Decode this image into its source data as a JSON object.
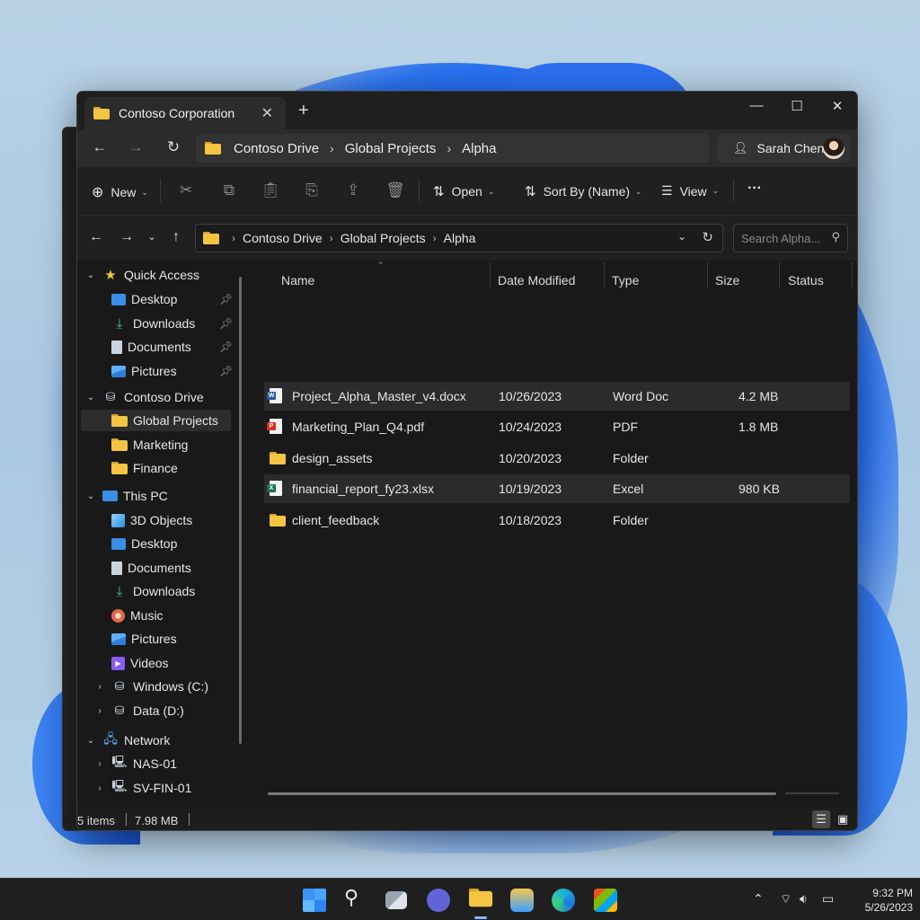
{
  "window": {
    "tab_title": "Contoso Corporation",
    "new_tab": "+",
    "close_tab": "✕",
    "minimize": "—",
    "maximize": "☐",
    "close": "✕"
  },
  "nav": {
    "breadcrumb": [
      "Contoso Drive",
      "Global Projects",
      "Alpha"
    ],
    "account_name": "Sarah Chen"
  },
  "toolbar": {
    "new_label": "New",
    "open_label": "Open",
    "sort_label": "Sort By (Name)",
    "view_label": "View",
    "more_label": "···"
  },
  "address": {
    "breadcrumb": [
      "Contoso Drive",
      "Global Projects",
      "Alpha"
    ],
    "search_placeholder": "Search Alpha..."
  },
  "sidebar": {
    "quick_access": {
      "label": "Quick Access",
      "items": [
        {
          "label": "Desktop",
          "icon": "desktop-icon",
          "pinned": true
        },
        {
          "label": "Downloads",
          "icon": "download-icon",
          "pinned": true
        },
        {
          "label": "Documents",
          "icon": "documents-icon",
          "pinned": true
        },
        {
          "label": "Pictures",
          "icon": "pictures-icon",
          "pinned": true
        }
      ]
    },
    "contoso_drive": {
      "label": "Contoso Drive",
      "items": [
        {
          "label": "Global Projects",
          "icon": "folder-icon",
          "selected": true
        },
        {
          "label": "Marketing",
          "icon": "folder-icon"
        },
        {
          "label": "Finance",
          "icon": "folder-icon"
        }
      ]
    },
    "this_pc": {
      "label": "This PC",
      "items": [
        {
          "label": "3D Objects",
          "icon": "3d-objects-icon"
        },
        {
          "label": "Desktop",
          "icon": "desktop-icon"
        },
        {
          "label": "Documents",
          "icon": "documents-icon"
        },
        {
          "label": "Downloads",
          "icon": "download-icon"
        },
        {
          "label": "Music",
          "icon": "music-icon"
        },
        {
          "label": "Pictures",
          "icon": "pictures-icon"
        },
        {
          "label": "Videos",
          "icon": "videos-icon"
        },
        {
          "label": "Windows (C:)",
          "icon": "drive-icon"
        },
        {
          "label": "Data (D:)",
          "icon": "drive-icon"
        }
      ]
    },
    "network": {
      "label": "Network",
      "items": [
        {
          "label": "NAS-01",
          "icon": "server-icon"
        },
        {
          "label": "SV-FIN-01",
          "icon": "server-icon"
        }
      ]
    }
  },
  "columns": [
    "Name",
    "Date Modified",
    "Type",
    "Size",
    "Status"
  ],
  "files": [
    {
      "name": "Project_Alpha_Master_v4.docx",
      "date": "10/26/2023",
      "type": "Word Doc",
      "size": "4.2 MB",
      "icon": "word-icon",
      "highlighted": true
    },
    {
      "name": "Marketing_Plan_Q4.pdf",
      "date": "10/24/2023",
      "type": "PDF",
      "size": "1.8 MB",
      "icon": "pdf-icon",
      "highlighted": false
    },
    {
      "name": "design_assets",
      "date": "10/20/2023",
      "type": "Folder",
      "size": "",
      "icon": "folder-icon",
      "highlighted": false
    },
    {
      "name": "financial_report_fy23.xlsx",
      "date": "10/19/2023",
      "type": "Excel",
      "size": "980 KB",
      "icon": "excel-icon",
      "highlighted": true
    },
    {
      "name": "client_feedback",
      "date": "10/18/2023",
      "type": "Folder",
      "size": "",
      "icon": "folder-icon",
      "highlighted": false
    }
  ],
  "status": {
    "items": "5 items",
    "size": "7.98 MB"
  },
  "taskbar": {
    "time": "9:32 PM",
    "date": "5/26/2023"
  },
  "colors": {
    "accent": "#f4c542",
    "word": "#2b579a",
    "pdf": "#d93025",
    "excel": "#1e7145"
  }
}
